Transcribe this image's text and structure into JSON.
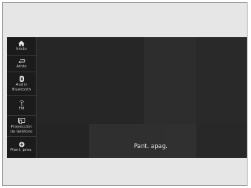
{
  "sidebar": {
    "items": [
      {
        "label": "Inicio",
        "icon": "home-icon"
      },
      {
        "label": "Atrás",
        "icon": "back-icon"
      },
      {
        "label": "Audio\nBluetooth",
        "icon": "bluetooth-icon"
      },
      {
        "label": "FM",
        "icon": "radio-antenna-icon"
      },
      {
        "label": "Proyección\nde teléfono",
        "icon": "phone-projection-icon"
      },
      {
        "label": "Mant. pres.",
        "icon": "plus-circle-icon"
      }
    ]
  },
  "screen": {
    "status_message": "Pant. apag."
  },
  "colors": {
    "screen_background": "#2a2a2a",
    "sidebar_background": "#1b1b1b",
    "text": "#e6e6e6"
  }
}
